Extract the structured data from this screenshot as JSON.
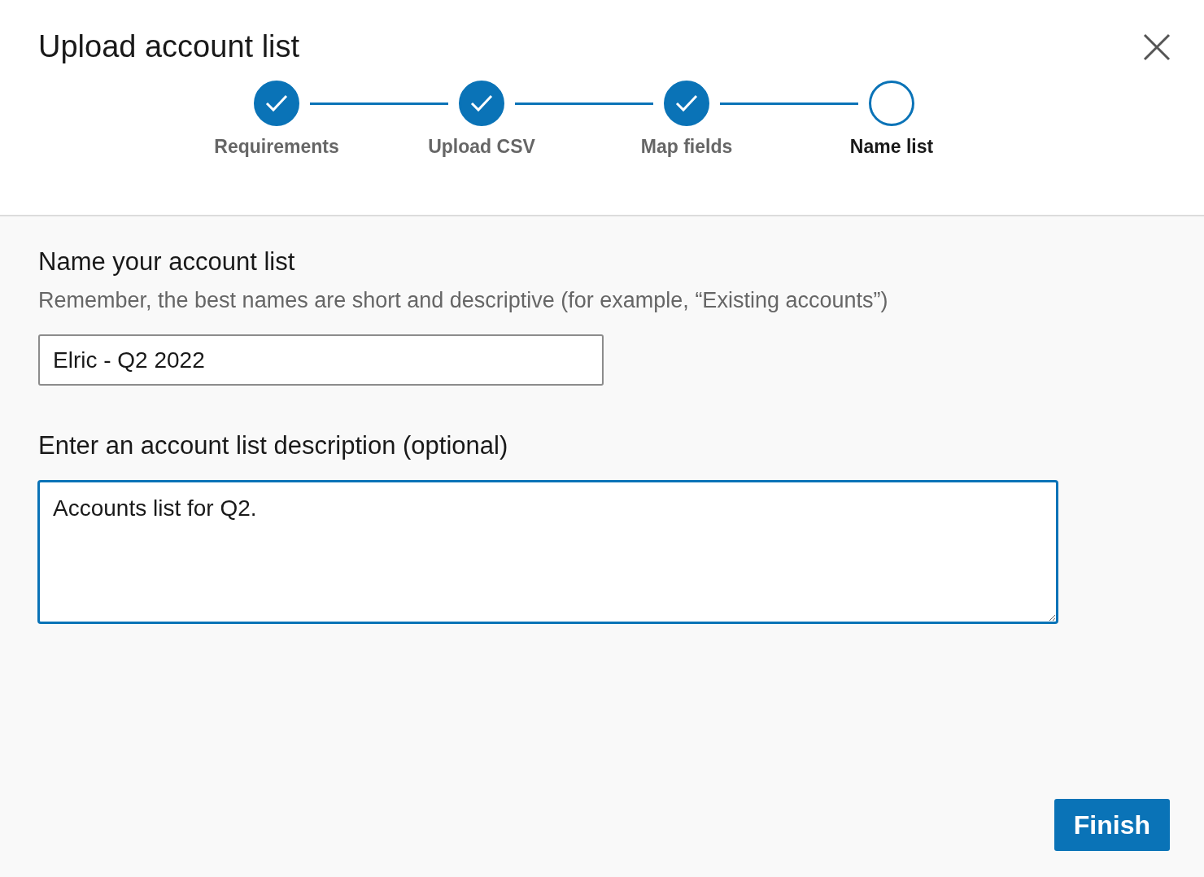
{
  "dialog": {
    "title": "Upload account list"
  },
  "steps": [
    {
      "label": "Requirements",
      "completed": true,
      "selected": false
    },
    {
      "label": "Upload CSV",
      "completed": true,
      "selected": false
    },
    {
      "label": "Map fields",
      "completed": true,
      "selected": false
    },
    {
      "label": "Name list",
      "completed": false,
      "selected": true
    }
  ],
  "name_section": {
    "heading": "Name your account list",
    "hint": "Remember, the best names are short and descriptive (for example, “Existing accounts”)",
    "value": "Elric - Q2 2022"
  },
  "description_section": {
    "heading": "Enter an account list description (optional)",
    "value": "Accounts list for Q2.",
    "focused": true
  },
  "buttons": [
    "Finish"
  ]
}
